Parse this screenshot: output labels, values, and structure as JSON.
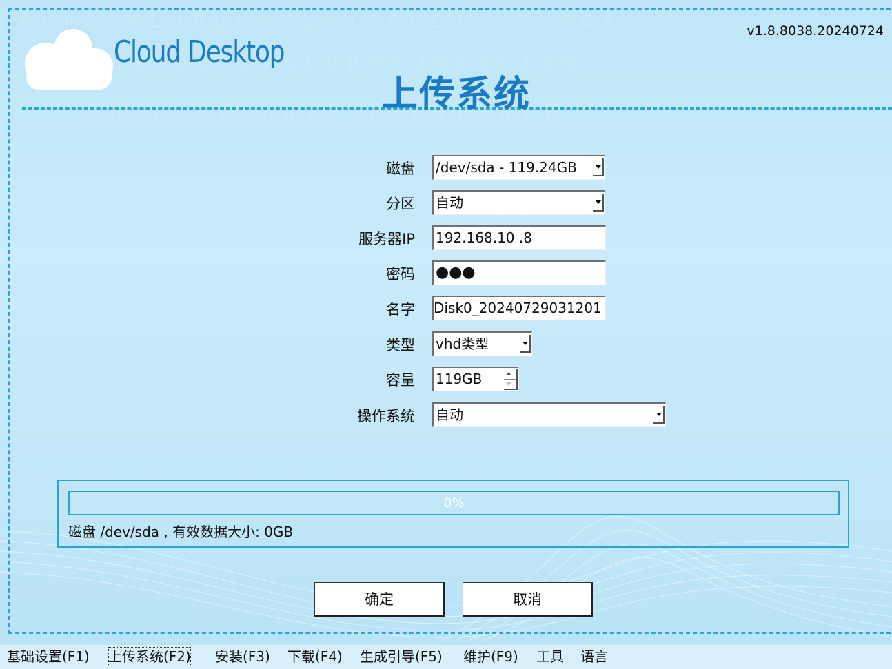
{
  "app": {
    "brand": "Cloud Desktop",
    "title": "上传系统",
    "version": "v1.8.8038.20240724"
  },
  "form": {
    "disk": {
      "label": "磁盘",
      "value": "/dev/sda - 119.24GB"
    },
    "partition": {
      "label": "分区",
      "value": "自动"
    },
    "server_ip": {
      "label": "服务器IP",
      "value": "192.168.10 .8"
    },
    "password": {
      "label": "密码",
      "value": "●●●"
    },
    "name": {
      "label": "名字",
      "value": "Disk0_20240729031201"
    },
    "type": {
      "label": "类型",
      "value": "vhd类型"
    },
    "capacity": {
      "label": "容量",
      "value": "119GB"
    },
    "os": {
      "label": "操作系统",
      "value": "自动"
    }
  },
  "progress": {
    "percent": 0,
    "percent_text": "0%",
    "status": "磁盘 /dev/sda , 有效数据大小: 0GB"
  },
  "buttons": {
    "confirm": "确定",
    "cancel": "取消"
  },
  "taskbar": {
    "items": [
      {
        "label": "基础设置(F1)",
        "active": false
      },
      {
        "label": "上传系统(F2)",
        "active": true
      },
      {
        "label": "安装(F3)",
        "active": false
      },
      {
        "label": "下载(F4)",
        "active": false
      },
      {
        "label": "生成引导(F5)",
        "active": false
      },
      {
        "label": "维护(F9)",
        "active": false
      },
      {
        "label": "工具",
        "active": false
      },
      {
        "label": "语言",
        "active": false
      }
    ]
  },
  "colors": {
    "accent": "#2aa3d8",
    "title": "#1a7bc4",
    "background": "#c6e9f9"
  },
  "icons": {
    "logo": "cloud-logo-icon",
    "dropdown": "chevron-down-icon",
    "spin_up": "spin-up-icon",
    "spin_down": "spin-down-icon"
  }
}
